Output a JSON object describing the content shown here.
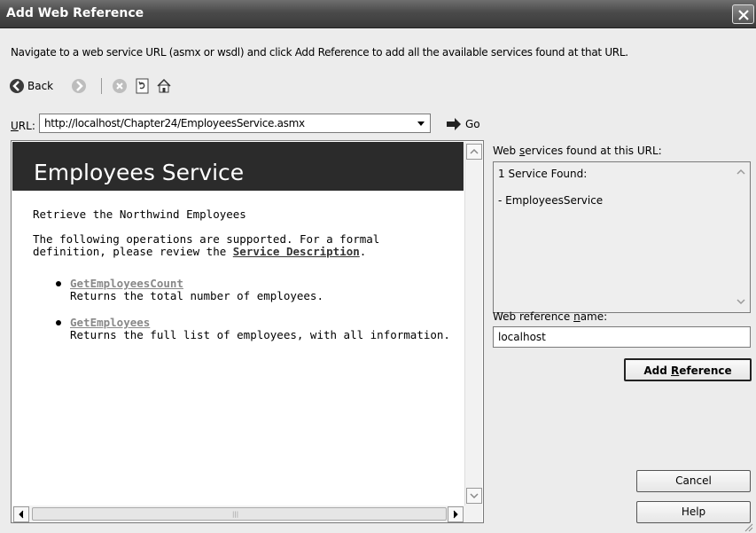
{
  "window": {
    "title": "Add Web Reference"
  },
  "instructions": "Navigate to a web service URL (asmx or wsdl) and click Add Reference to add all the available services found at that URL.",
  "toolbar": {
    "back_label": "Back"
  },
  "url_bar": {
    "label_prefix": "U",
    "label_rest": "RL:",
    "value": "http://localhost/Chapter24/EmployeesService.asmx",
    "go_label": "Go"
  },
  "browser": {
    "service_title": "Employees Service",
    "description": "Retrieve the Northwind Employees",
    "ops_intro": "The following operations are supported. For a formal definition, please review the",
    "service_description_link": "Service Description",
    "operations": [
      {
        "name": "GetEmployeesCount",
        "desc": "Returns the total number of employees."
      },
      {
        "name": "GetEmployees",
        "desc": "Returns the full list of employees, with all information."
      }
    ]
  },
  "services_panel": {
    "label_pre": "Web ",
    "label_key": "s",
    "label_post": "ervices found at this URL:",
    "found_count": "1 Service Found:",
    "services": [
      "- EmployeesService"
    ]
  },
  "reference": {
    "label_pre": "Web reference ",
    "label_key": "n",
    "label_post": "ame:",
    "name_value": "localhost"
  },
  "buttons": {
    "add_pre": "Add ",
    "add_key": "R",
    "add_post": "eference",
    "cancel": "Cancel",
    "help": "Help"
  },
  "icons": [
    "back-icon",
    "forward-icon",
    "stop-icon",
    "refresh-icon",
    "home-icon",
    "go-icon",
    "close-icon"
  ]
}
